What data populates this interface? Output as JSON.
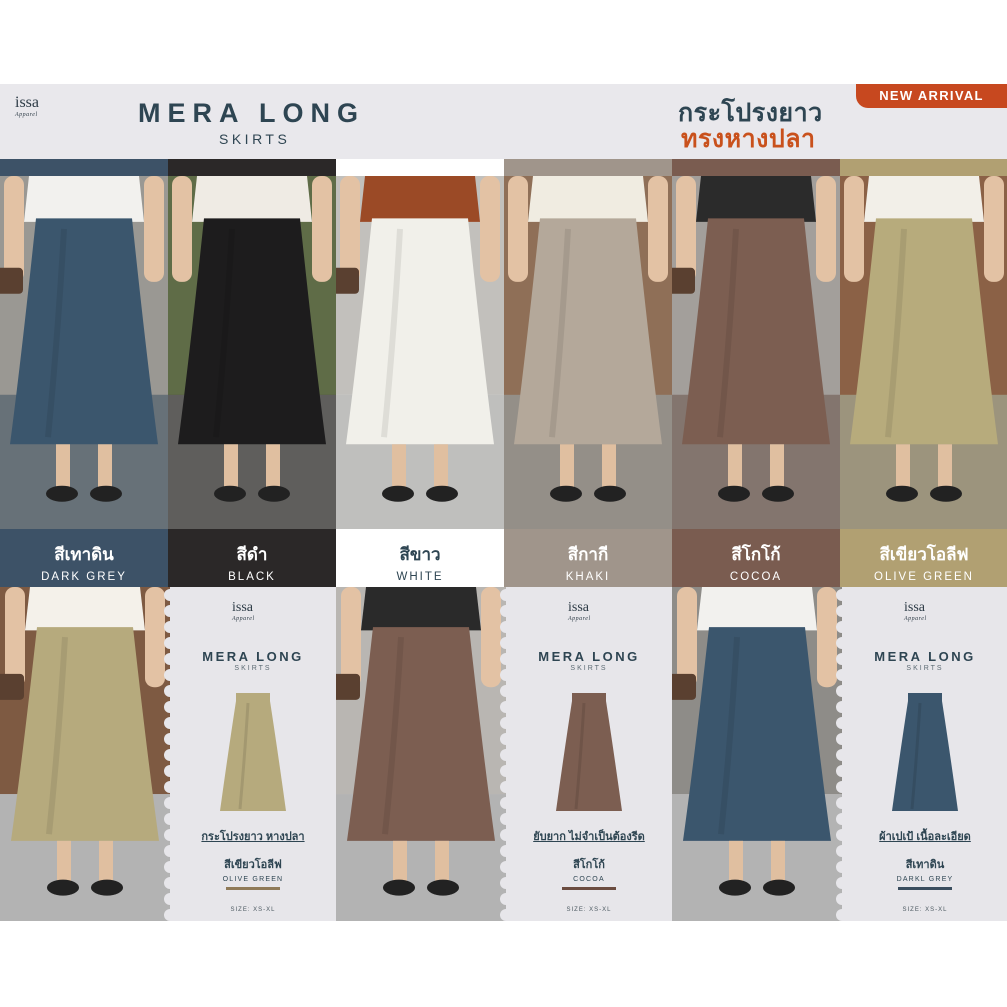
{
  "brand": {
    "name": "issa",
    "tagline": "Apparel"
  },
  "header": {
    "title": "MERA LONG",
    "subtitle": "SKIRTS",
    "thai_line1": "กระโปรงยาว",
    "thai_line2": "ทรงหางปลา",
    "badge": "NEW ARRIVAL"
  },
  "colors": {
    "navy": "#2e4552",
    "accent": "#c7481f",
    "banner_bg": "#e9e8ec"
  },
  "swatches": [
    {
      "th": "สีเทาดิน",
      "en": "DARK GREY",
      "label_bg": "#3d5267",
      "skirt": "#3b566d",
      "top": "#f2f1ee",
      "bg": "#9a9893"
    },
    {
      "th": "สีดำ",
      "en": "BLACK",
      "label_bg": "#2b2828",
      "skirt": "#1d1c1d",
      "top": "#efebe4",
      "bg": "#5f6c47"
    },
    {
      "th": "สีขาว",
      "en": "WHITE",
      "label_bg": "#ffffff",
      "skirt": "#f1f0ea",
      "top": "#9b4a26",
      "bg": "#c2c0bc"
    },
    {
      "th": "สีกากี",
      "en": "KHAKI",
      "label_bg": "#a0958b",
      "skirt": "#b4a89a",
      "top": "#f0ece1",
      "bg": "#8f6f57"
    },
    {
      "th": "สีโกโก้",
      "en": "COCOA",
      "label_bg": "#7a5c50",
      "skirt": "#7c5e51",
      "top": "#2b2b2b",
      "bg": "#a39f9b"
    },
    {
      "th": "สีเขียวโอลีฟ",
      "en": "OLIVE GREEN",
      "label_bg": "#b1a072",
      "skirt": "#b7ab7c",
      "top": "#f2efe8",
      "bg": "#8b6146"
    }
  ],
  "panels": [
    {
      "title": "MERA LONG",
      "subtitle": "SKIRTS",
      "desc": "กระโปรงยาว หางปลา",
      "th": "สีเขียวโอลีฟ",
      "en": "OLIVE GREEN",
      "size": "SIZE: XS-XL",
      "skirt": "#b6aa7d",
      "line": "#8f7a58",
      "top": "#f4f1ea",
      "bg": "#7e5a42"
    },
    {
      "title": "MERA LONG",
      "subtitle": "SKIRTS",
      "desc": "ยับยาก ไม่จำเป็นต้องรีด",
      "th": "สีโกโก้",
      "en": "COCOA",
      "size": "SIZE: XS-XL",
      "skirt": "#7c5e51",
      "line": "#6b4c40",
      "top": "#2a2a2a",
      "bg": "#b9b6b2"
    },
    {
      "title": "MERA LONG",
      "subtitle": "SKIRTS",
      "desc": "ผ้าเปเป้ เนื้อละเอียด",
      "th": "สีเทาดิน",
      "en": "DARKL GREY",
      "size": "SIZE: XS-XL",
      "skirt": "#3b566d",
      "line": "#3a4d5e",
      "top": "#f2f1ee",
      "bg": "#8e8c88"
    }
  ]
}
